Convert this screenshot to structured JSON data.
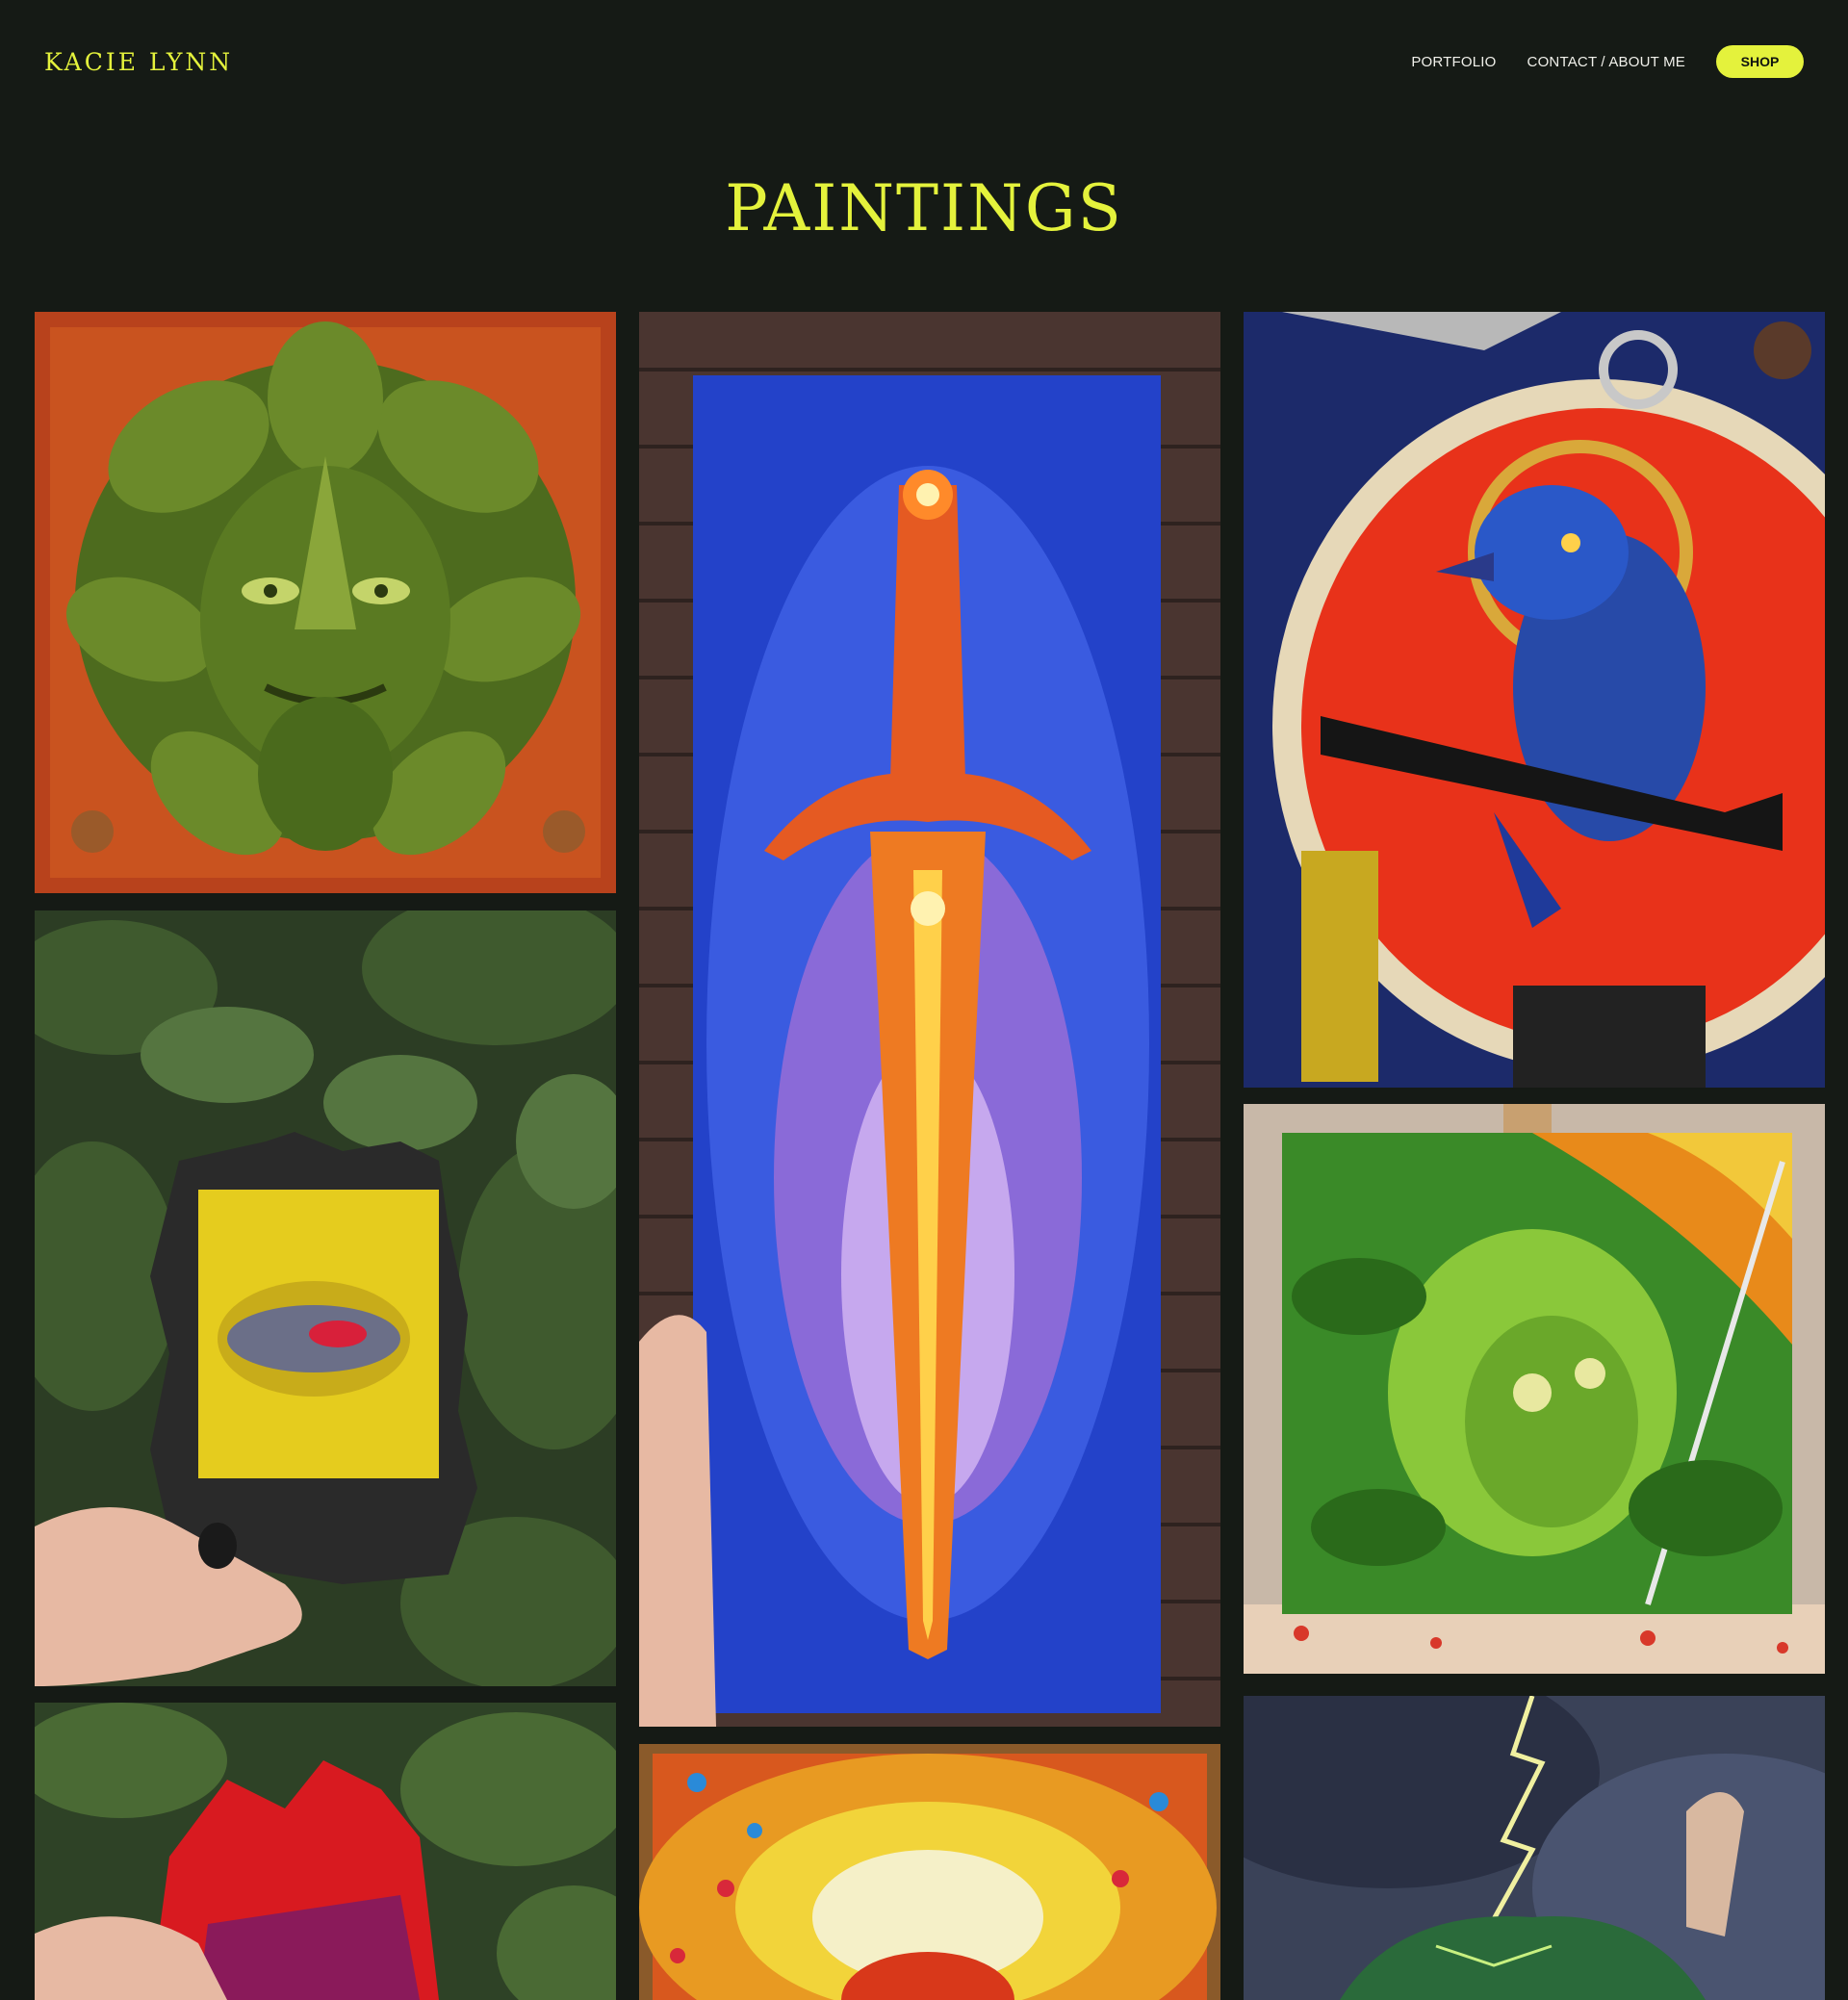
{
  "site": {
    "logo": "KACIE LYNN"
  },
  "nav": {
    "portfolio": "PORTFOLIO",
    "contact": "CONTACT / ABOUT ME",
    "shop": "SHOP"
  },
  "page": {
    "title": "PAINTINGS"
  },
  "colors": {
    "background": "#151a15",
    "accent": "#e4f23c",
    "nav_text": "#f0f0ea"
  },
  "gallery": [
    {
      "name": "green-man-painting"
    },
    {
      "name": "sword-painting"
    },
    {
      "name": "raven-painting"
    },
    {
      "name": "eye-painting-framed"
    },
    {
      "name": "forest-woman-painting"
    },
    {
      "name": "red-framed-painting"
    },
    {
      "name": "sunburst-painting"
    },
    {
      "name": "lightning-painting"
    }
  ]
}
